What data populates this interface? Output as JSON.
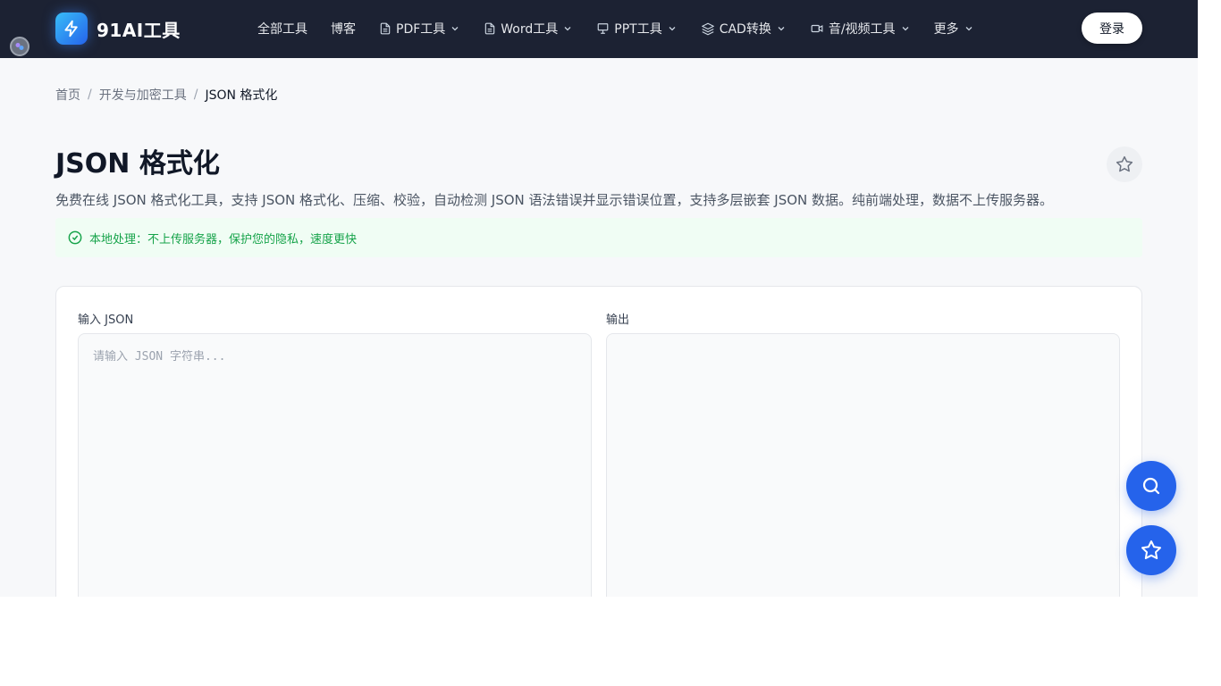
{
  "header": {
    "brand": "91AI工具",
    "nav": [
      {
        "label": "全部工具",
        "icon": null,
        "dropdown": false
      },
      {
        "label": "博客",
        "icon": null,
        "dropdown": false
      },
      {
        "label": "PDF工具",
        "icon": "file-icon",
        "dropdown": true
      },
      {
        "label": "Word工具",
        "icon": "file-icon",
        "dropdown": true
      },
      {
        "label": "PPT工具",
        "icon": "presentation-icon",
        "dropdown": true
      },
      {
        "label": "CAD转换",
        "icon": "layers-icon",
        "dropdown": true
      },
      {
        "label": "音/视频工具",
        "icon": "video-icon",
        "dropdown": true
      },
      {
        "label": "更多",
        "icon": null,
        "dropdown": true
      }
    ],
    "login_label": "登录"
  },
  "breadcrumb": {
    "home": "首页",
    "category": "开发与加密工具",
    "current": "JSON 格式化",
    "separator": "/"
  },
  "page": {
    "title": "JSON 格式化",
    "description": "免费在线 JSON 格式化工具，支持 JSON 格式化、压缩、校验，自动检测 JSON 语法错误并显示错误位置，支持多层嵌套 JSON 数据。纯前端处理，数据不上传服务器。",
    "notice": "本地处理：不上传服务器，保护您的隐私，速度更快"
  },
  "editor": {
    "input_label": "输入 JSON",
    "input_placeholder": "请输入 JSON 字符串...",
    "input_value": "",
    "output_label": "输出",
    "output_value": ""
  },
  "colors": {
    "navbar": "#1c2233",
    "accent": "#2563eb",
    "notice_bg": "#f0fdf4",
    "notice_text": "#16a34a"
  }
}
